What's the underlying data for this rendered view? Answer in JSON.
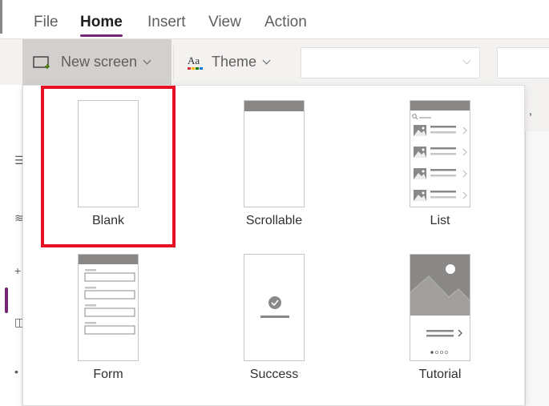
{
  "menu": {
    "tabs": [
      {
        "label": "File"
      },
      {
        "label": "Home",
        "active": true
      },
      {
        "label": "Insert"
      },
      {
        "label": "View"
      },
      {
        "label": "Action"
      }
    ],
    "active_underline_color": "#742774"
  },
  "ribbon": {
    "new_screen_label": "New screen",
    "new_screen_icon": "new-screen-icon",
    "theme_label": "Theme",
    "theme_icon_text": "Aa",
    "dropdown_value": ""
  },
  "flyout": {
    "highlight_color": "#e81123",
    "highlighted_tile": "Blank",
    "tiles": [
      {
        "label": "Blank"
      },
      {
        "label": "Scrollable"
      },
      {
        "label": "List"
      },
      {
        "label": "Form"
      },
      {
        "label": "Success"
      },
      {
        "label": "Tutorial"
      }
    ]
  },
  "background": {
    "comma": ","
  },
  "colors": {
    "accent": "#742774",
    "ribbon_bg": "#f3f2f1",
    "button_pressed": "#d2d0ce",
    "thumbnail_gray": "#8a8886"
  }
}
